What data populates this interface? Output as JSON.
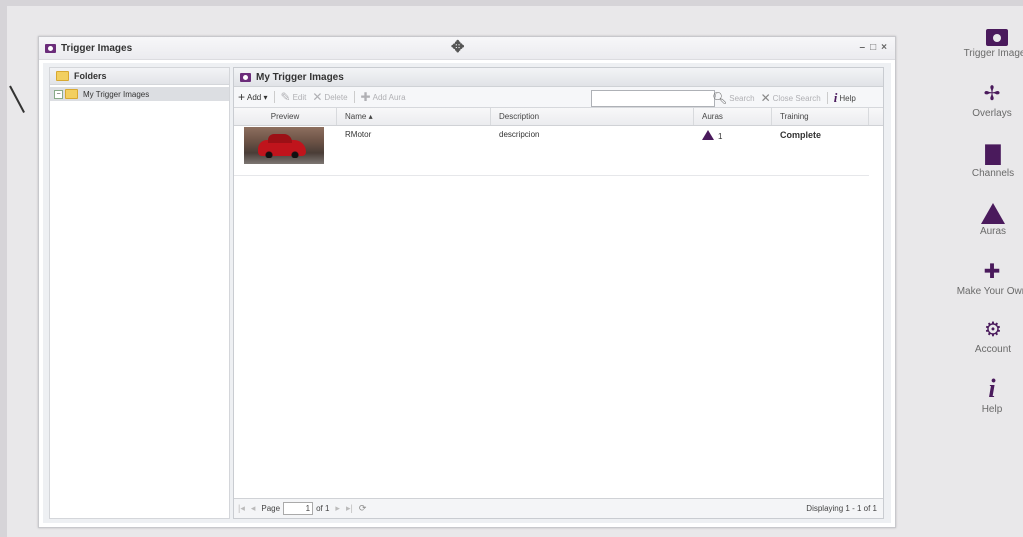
{
  "window": {
    "title": "Trigger Images",
    "controls": [
      "–",
      "□",
      "×"
    ]
  },
  "folders": {
    "header": "Folders",
    "tree": [
      {
        "label": "My Trigger Images",
        "toggle": "−"
      }
    ]
  },
  "grid": {
    "title": "My Trigger Images",
    "toolbar": {
      "add": "Add ▾",
      "edit": "Edit",
      "delete": "Delete",
      "add_aura": "Add Aura",
      "search_value": "",
      "search": "Search",
      "close_search": "Close Search",
      "help": "Help"
    },
    "columns": [
      "Preview",
      "Name ▴",
      "Description",
      "Auras",
      "Training"
    ],
    "rows": [
      {
        "name": "RMotor",
        "description": "descripcion",
        "auras": "1",
        "training": "Complete"
      }
    ],
    "pager": {
      "page_label": "Page",
      "page_value": "1",
      "of_label": "of 1",
      "displaying": "Displaying 1 - 1 of 1"
    }
  },
  "sidenav": {
    "items": [
      {
        "label": "Trigger Images",
        "icon": "camera-icon"
      },
      {
        "label": "Overlays",
        "icon": "overlays-icon"
      },
      {
        "label": "Channels",
        "icon": "channels-icon"
      },
      {
        "label": "Auras",
        "icon": "aura-triangle-icon"
      },
      {
        "label": "Make Your Own",
        "icon": "puzzle-icon"
      },
      {
        "label": "Account",
        "icon": "gears-icon"
      },
      {
        "label": "Help",
        "icon": "info-icon"
      }
    ]
  },
  "colors": {
    "brand": "#4a1a5c",
    "background": "#e9e8ea"
  }
}
